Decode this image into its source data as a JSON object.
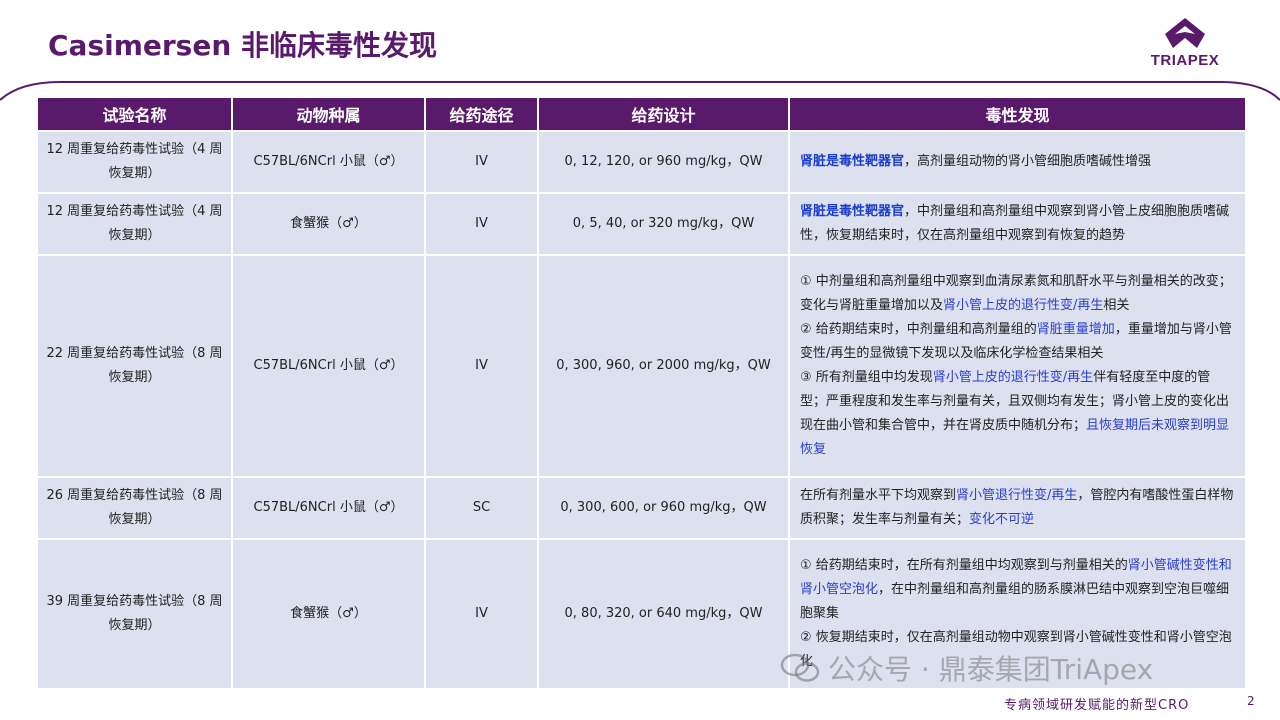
{
  "title": "Casimersen 非临床毒性发现",
  "logo_text": "TRIAPEX",
  "headers": [
    "试验名称",
    "动物种属",
    "给药途径",
    "给药设计",
    "毒性发现"
  ],
  "rows": [
    {
      "name": "12 周重复给药毒性试验（4 周恢复期）",
      "species": "C57BL/6NCrl 小鼠（♂）",
      "route": "IV",
      "design": "0, 12, 120, or 960 mg/kg，QW",
      "f": [
        "肾脏是毒性靶器官",
        "，高剂量组动物的肾小管细胞质嗜碱性增强"
      ]
    },
    {
      "name": "12 周重复给药毒性试验（4 周恢复期）",
      "species": "食蟹猴（♂）",
      "route": "IV",
      "design": "0, 5, 40, or 320 mg/kg，QW",
      "f": [
        "肾脏是毒性靶器官",
        "，中剂量组和高剂量组中观察到肾小管上皮细胞胞质嗜碱性，恢复期结束时，仅在高剂量组中观察到有恢复的趋势"
      ]
    },
    {
      "name": "22 周重复给药毒性试验（8 周恢复期）",
      "species": "C57BL/6NCrl 小鼠（♂）",
      "route": "IV",
      "design": "0, 300, 960, or 2000 mg/kg，QW",
      "f": [
        "① 中剂量组和高剂量组中观察到血清尿素氮和肌酐水平与剂量相关的改变；变化与肾脏重量增加以及",
        "肾小管上皮的退行性变/再生",
        "相关",
        "② 给药期结束时，中剂量组和高剂量组的",
        "肾脏重量增加",
        "，重量增加与肾小管变性/再生的显微镜下发现以及临床化学检查结果相关",
        "③ 所有剂量组中均发现",
        "肾小管上皮的退行性变/再生",
        "伴有轻度至中度的管型；严重程度和发生率与剂量有关，且双侧均有发生；肾小管上皮的变化出现在曲小管和集合管中，并在肾皮质中随机分布；",
        "且恢复期后未观察到明显恢复"
      ]
    },
    {
      "name": "26 周重复给药毒性试验（8 周恢复期）",
      "species": "C57BL/6NCrl 小鼠（♂）",
      "route": "SC",
      "design": "0, 300, 600, or 960 mg/kg，QW",
      "f": [
        "在所有剂量水平下均观察到",
        "肾小管退行性变/再生",
        "，管腔内有嗜酸性蛋白样物质积聚；发生率与剂量有关；",
        "变化不可逆"
      ]
    },
    {
      "name": "39 周重复给药毒性试验（8 周恢复期）",
      "species": "食蟹猴（♂）",
      "route": "IV",
      "design": "0, 80, 320, or 640 mg/kg，QW",
      "f": [
        "① 给药期结束时，在所有剂量组中均观察到与剂量相关的",
        "肾小管碱性变性和肾小管空泡化",
        "，在中剂量组和高剂量组的肠系膜淋巴结中观察到空泡巨噬细胞聚集",
        "② 恢复期结束时，仅在高剂量组动物中观察到肾小管碱性变性和肾小管空泡化"
      ]
    }
  ],
  "watermark": "公众号 · 鼎泰集团TriApex",
  "footer": "专病领域研发赋能的新型CRO",
  "page_number": "2",
  "colors": {
    "brand": "#5a1a6b",
    "cell": "#dde0ef",
    "highlight": "#1a3dcc"
  }
}
